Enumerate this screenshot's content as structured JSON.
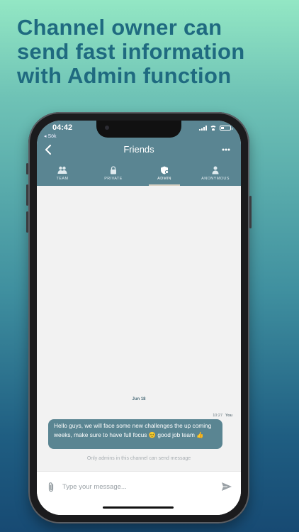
{
  "headline": "Channel owner can\nsend fast information\nwith Admin function",
  "status_bar": {
    "time": "04:42",
    "back_app": "◂ Sök"
  },
  "chat_header": {
    "title": "Friends",
    "back_icon": "chevron-left-icon",
    "more_icon": "more-dots-icon"
  },
  "tabs": [
    {
      "label": "TEAM",
      "icon": "group-icon",
      "active": false
    },
    {
      "label": "PRIVATE",
      "icon": "lock-icon",
      "active": false
    },
    {
      "label": "ADMIN",
      "icon": "admin-shield-icon",
      "active": true
    },
    {
      "label": "ANONYMOUS",
      "icon": "person-icon",
      "active": false
    }
  ],
  "messages": [
    {
      "date": "Jun 18",
      "time": "10:27",
      "sender": "You",
      "text": "Hello guys, we will face some new challenges the up coming weeks, make sure to have full focus 😊 good job team 👍"
    }
  ],
  "notice": "Only admins in this channel can send message",
  "composer": {
    "placeholder": "Type your message...",
    "attach_icon": "paperclip-icon",
    "send_icon": "send-icon"
  },
  "colors": {
    "header": "#5a8592",
    "bubble": "#5a8592",
    "headline": "#1f6a80"
  }
}
